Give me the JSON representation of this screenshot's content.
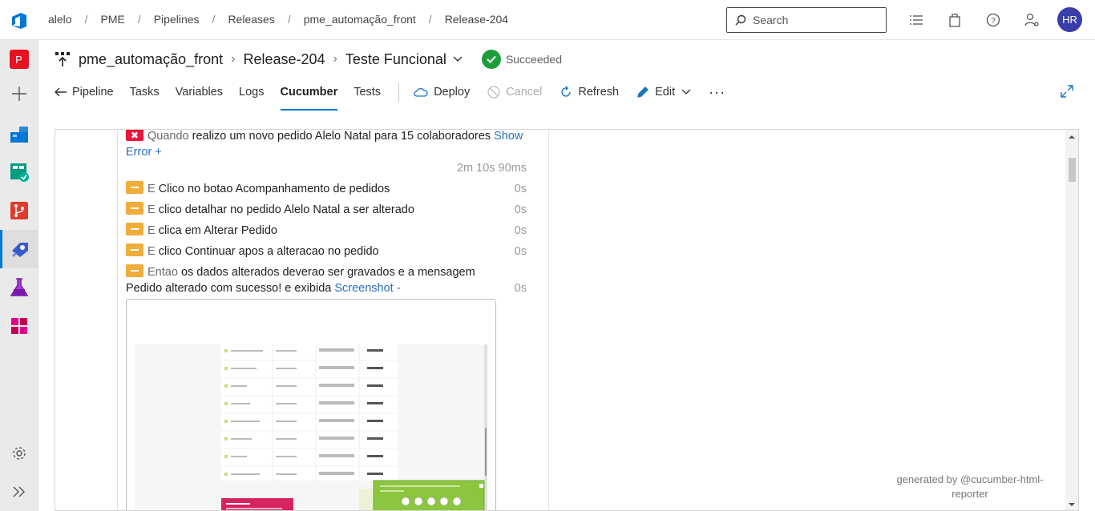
{
  "breadcrumb": [
    "alelo",
    "PME",
    "Pipelines",
    "Releases",
    "pme_automação_front",
    "Release-204"
  ],
  "search": {
    "placeholder": "Search"
  },
  "user": {
    "initials": "HR"
  },
  "project": {
    "letter": "P"
  },
  "title": {
    "pipeline": "pme_automação_front",
    "release": "Release-204",
    "stage": "Teste Funcional",
    "status": "Succeeded"
  },
  "tabs": {
    "pipeline": "Pipeline",
    "tasks": "Tasks",
    "variables": "Variables",
    "logs": "Logs",
    "cucumber": "Cucumber",
    "tests": "Tests"
  },
  "actions": {
    "deploy": "Deploy",
    "cancel": "Cancel",
    "refresh": "Refresh",
    "edit": "Edit"
  },
  "steps": [
    {
      "status": "failed",
      "keyword": "Quando",
      "text": "realizo um novo pedido Alelo Natal para 15 colaboradores",
      "link": "Show Error +",
      "duration": "2m 10s 90ms"
    },
    {
      "status": "skipped",
      "keyword": "E",
      "text": "Clico no botao Acompanhamento de pedidos",
      "duration": "0s"
    },
    {
      "status": "skipped",
      "keyword": "E",
      "text": "clico detalhar no pedido Alelo Natal a ser alterado",
      "duration": "0s"
    },
    {
      "status": "skipped",
      "keyword": "E",
      "text": "clica em Alterar Pedido",
      "duration": "0s"
    },
    {
      "status": "skipped",
      "keyword": "E",
      "text": "clico Continuar apos a alteracao no pedido",
      "duration": "0s"
    },
    {
      "status": "skipped",
      "keyword": "Entao",
      "text": "os dados alterados deverao ser gravados e a mensagem Pedido alterado com sucesso! e exibida",
      "link": "Screenshot -",
      "duration": "0s"
    }
  ],
  "footer": {
    "generated_by": "generated by @cucumber-html-reporter"
  },
  "colors": {
    "accent": "#0078d4",
    "success": "#1f9d3c",
    "failed": "#e8173b",
    "skipped": "#f0ad3a"
  }
}
